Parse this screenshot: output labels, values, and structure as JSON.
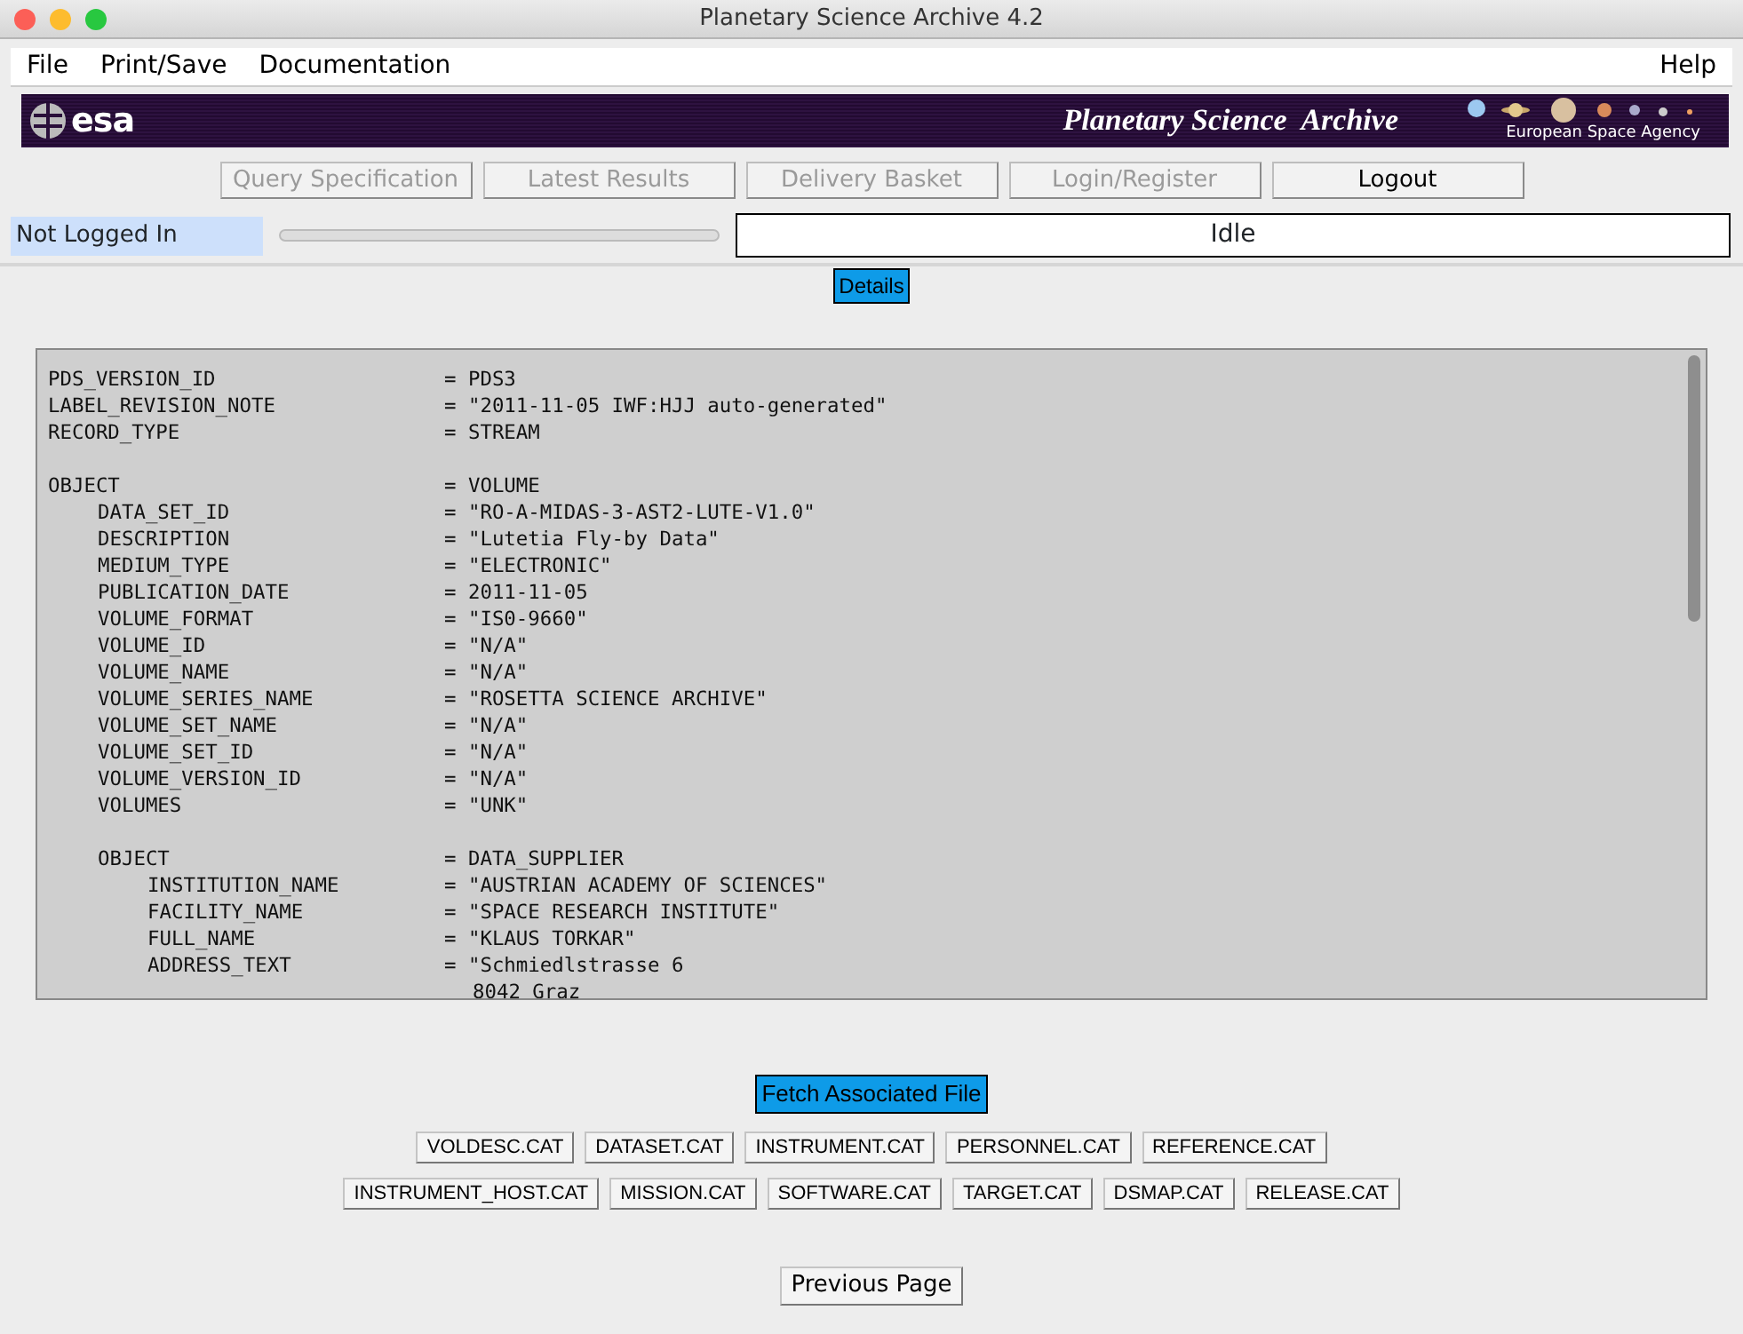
{
  "window": {
    "title": "Planetary Science Archive 4.2"
  },
  "menu": {
    "left": [
      "File",
      "Print/Save",
      "Documentation"
    ],
    "right": [
      "Help"
    ]
  },
  "banner": {
    "logo": "esa",
    "title": "Planetary Science  Archive",
    "agency": "European Space Agency"
  },
  "nav_buttons": [
    {
      "label": "Query Specification",
      "disabled": true
    },
    {
      "label": "Latest Results",
      "disabled": true
    },
    {
      "label": "Delivery Basket",
      "disabled": true
    },
    {
      "label": "Login/Register",
      "disabled": true
    },
    {
      "label": "Logout",
      "disabled": false
    }
  ],
  "status": {
    "login": "Not Logged In",
    "progress": {
      "level": 0
    },
    "state": "Idle"
  },
  "details_button": "Details",
  "label": [
    {
      "key": "PDS_VERSION_ID",
      "value": "= PDS3"
    },
    {
      "key": "LABEL_REVISION_NOTE",
      "value": "= \"2011-11-05 IWF:HJJ auto-generated\""
    },
    {
      "key": "RECORD_TYPE",
      "value": "= STREAM"
    },
    {
      "key": "OBJECT",
      "value": "= VOLUME",
      "children": [
        {
          "key": "DATA_SET_ID",
          "value": "= \"RO-A-MIDAS-3-AST2-LUTE-V1.0\""
        },
        {
          "key": "DESCRIPTION",
          "value": "= \"Lutetia Fly-by Data\""
        },
        {
          "key": "MEDIUM_TYPE",
          "value": "= \"ELECTRONIC\""
        },
        {
          "key": "PUBLICATION_DATE",
          "value": "= 2011-11-05"
        },
        {
          "key": "VOLUME_FORMAT",
          "value": "= \"IS0-9660\""
        },
        {
          "key": "VOLUME_ID",
          "value": "= \"N/A\""
        },
        {
          "key": "VOLUME_NAME",
          "value": "= \"N/A\""
        },
        {
          "key": "VOLUME_SERIES_NAME",
          "value": "= \"ROSETTA SCIENCE ARCHIVE\""
        },
        {
          "key": "VOLUME_SET_NAME",
          "value": "= \"N/A\""
        },
        {
          "key": "VOLUME_SET_ID",
          "value": "= \"N/A\""
        },
        {
          "key": "VOLUME_VERSION_ID",
          "value": "= \"N/A\""
        },
        {
          "key": "VOLUMES",
          "value": "= \"UNK\""
        },
        {
          "key": "OBJECT",
          "value": "= DATA_SUPPLIER",
          "children": [
            {
              "key": "INSTITUTION_NAME",
              "value": "= \"AUSTRIAN ACADEMY OF SCIENCES\""
            },
            {
              "key": "FACILITY_NAME",
              "value": "= \"SPACE RESEARCH INSTITUTE\""
            },
            {
              "key": "FULL_NAME",
              "value": "= \"KLAUS TORKAR\""
            },
            {
              "key": "ADDRESS_TEXT",
              "value": "= \"Schmiedlstrasse 6",
              "continuation": "8042 Graz"
            }
          ]
        }
      ]
    }
  ],
  "fetch_button": "Fetch Associated File",
  "file_buttons": [
    [
      "VOLDESC.CAT",
      "DATASET.CAT",
      "INSTRUMENT.CAT",
      "PERSONNEL.CAT",
      "REFERENCE.CAT"
    ],
    [
      "INSTRUMENT_HOST.CAT",
      "MISSION.CAT",
      "SOFTWARE.CAT",
      "TARGET.CAT",
      "DSMAP.CAT",
      "RELEASE.CAT"
    ]
  ],
  "previous_button": "Previous Page"
}
